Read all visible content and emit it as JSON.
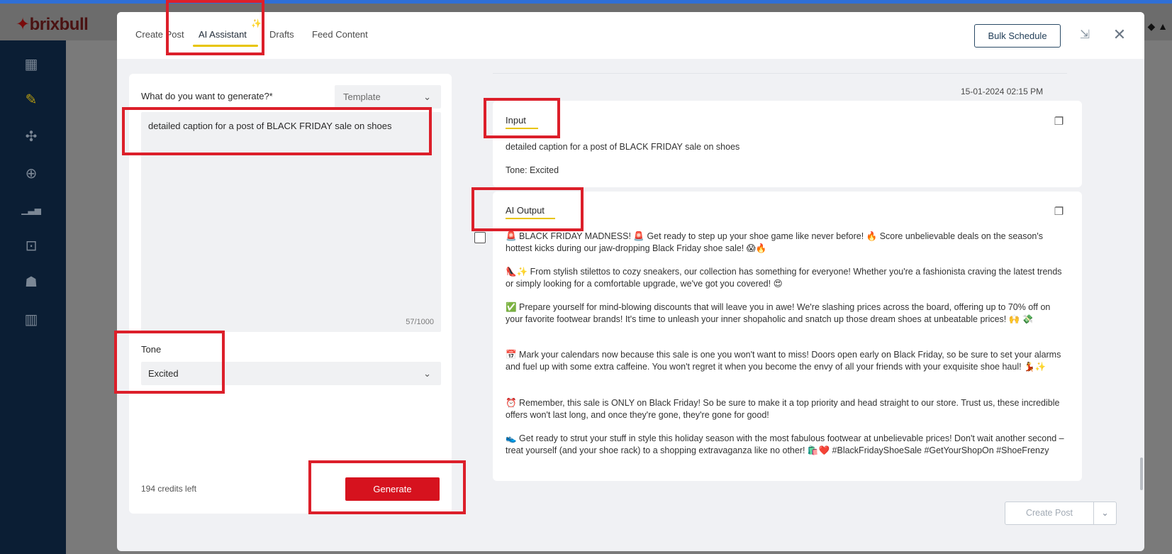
{
  "app": {
    "logo": "brixbull"
  },
  "sidebar": {
    "items": [
      {
        "name": "dashboard-icon",
        "glyph": "▦"
      },
      {
        "name": "compose-icon",
        "glyph": "✎"
      },
      {
        "name": "network-icon",
        "glyph": "✣"
      },
      {
        "name": "target-icon",
        "glyph": "⊕"
      },
      {
        "name": "analytics-icon",
        "glyph": "▁▃▅"
      },
      {
        "name": "inbox-icon",
        "glyph": "⊡"
      },
      {
        "name": "team-icon",
        "glyph": "☗"
      },
      {
        "name": "library-icon",
        "glyph": "▥"
      }
    ]
  },
  "modal": {
    "tabs": [
      "Create Post",
      "AI Assistant",
      "Drafts",
      "Feed Content"
    ],
    "active_tab": "AI Assistant",
    "bulk_schedule": "Bulk Schedule"
  },
  "left": {
    "generate_label": "What do you want to generate?*",
    "template_value": "Template",
    "prompt": "detailed caption for a post of BLACK FRIDAY sale on shoes",
    "char_count": "57/1000",
    "tone_label": "Tone",
    "tone_value": "Excited",
    "credits": "194 credits left",
    "generate_button": "Generate"
  },
  "right": {
    "timestamp": "15-01-2024 02:15 PM",
    "input_label": "Input",
    "input_text": "detailed caption for a post of BLACK FRIDAY sale on shoes",
    "input_tone": "Tone: Excited",
    "output_label": "AI Output",
    "output_paragraphs": [
      "🚨 BLACK FRIDAY MADNESS! 🚨 Get ready to step up your shoe game like never before! 🔥 Score unbelievable deals on the season's hottest kicks during our jaw-dropping Black Friday shoe sale! 😱🔥",
      "👠✨ From stylish stilettos to cozy sneakers, our collection has something for everyone! Whether you're a fashionista craving the latest trends or simply looking for a comfortable upgrade, we've got you covered! 😍",
      "✅ Prepare yourself for mind-blowing discounts that will leave you in awe! We're slashing prices across the board, offering up to 70% off on your favorite footwear brands! It's time to unleash your inner shopaholic and snatch up those dream shoes at unbeatable prices! 🙌 💸",
      "📅 Mark your calendars now because this sale is one you won't want to miss! Doors open early on Black Friday, so be sure to set your alarms and fuel up with some extra caffeine. You won't regret it when you become the envy of all your friends with your exquisite shoe haul! 💃✨",
      "⏰ Remember, this sale is ONLY on Black Friday! So be sure to make it a top priority and head straight to our store. Trust us, these incredible offers won't last long, and once they're gone, they're gone for good!",
      "👟 Get ready to strut your stuff in style this holiday season with the most fabulous footwear at unbelievable prices! Don't wait another second – treat yourself (and your shoe rack) to a shopping extravaganza like no other! 🛍️❤️ #BlackFridayShoeSale #GetYourShopOn #ShoeFrenzy"
    ],
    "create_post": "Create Post"
  },
  "colors": {
    "accent_yellow": "#e8c400",
    "generate_red": "#d6121e",
    "sidebar_bg": "#0b1e34",
    "annotation_red": "#dc1f2a"
  }
}
